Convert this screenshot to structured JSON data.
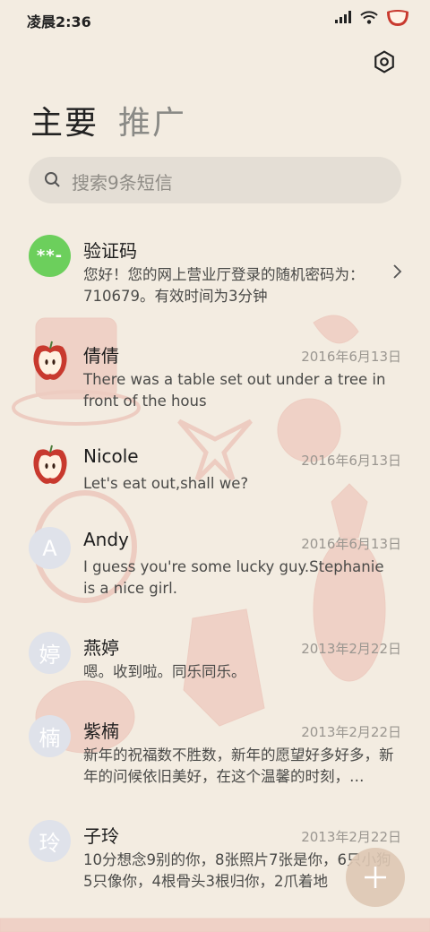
{
  "status": {
    "time": "凌晨2:36"
  },
  "tabs": [
    {
      "label": "主要"
    },
    {
      "label": "推广"
    }
  ],
  "search": {
    "placeholder": "搜索9条短信"
  },
  "conversations": [
    {
      "name": "验证码",
      "date": "",
      "avatar_text": "**-",
      "preview": "您好！您的网上营业厅登录的随机密码为：710679。有效时间为3分钟"
    },
    {
      "name": "倩倩",
      "date": "2016年6月13日",
      "avatar_text": "",
      "preview": "There was a table set out under a tree in front of the hous"
    },
    {
      "name": "Nicole",
      "date": "2016年6月13日",
      "avatar_text": "",
      "preview": "Let's eat out,shall we?"
    },
    {
      "name": "Andy",
      "date": "2016年6月13日",
      "avatar_text": "A",
      "preview": "I guess you're some lucky guy.Stephanie is a nice girl."
    },
    {
      "name": "燕婷",
      "date": "2013年2月22日",
      "avatar_text": "婷",
      "preview": "嗯。收到啦。同乐同乐。"
    },
    {
      "name": "紫楠",
      "date": "2013年2月22日",
      "avatar_text": "楠",
      "preview": "新年的祝福数不胜数，新年的愿望好多好多，新年的问候依旧美好，在这个温馨的时刻，…"
    },
    {
      "name": "子玲",
      "date": "2013年2月22日",
      "avatar_text": "玲",
      "preview": "10分想念9别的你，8张照片7张是你，6只小狗5只像你，4根骨头3根归你，2爪着地"
    }
  ],
  "colors": {
    "background": "#f3ece1",
    "accent_green": "#6ccf5c",
    "apple_red": "#c8392e"
  },
  "icons": {
    "settings": "gear-icon",
    "search": "search-icon",
    "compose": "plus-icon",
    "chevron": "chevron-right-icon"
  }
}
